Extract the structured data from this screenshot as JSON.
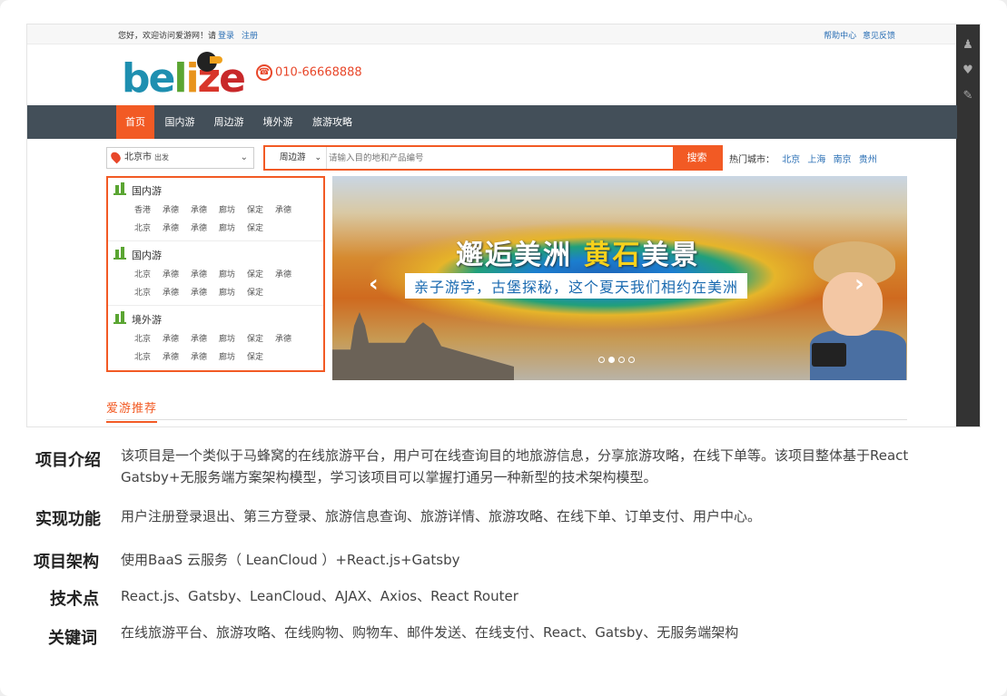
{
  "top": {
    "greeting": "您好，欢迎访问爱游网！请",
    "login": "登录",
    "register": "注册",
    "help": "帮助中心",
    "feedback": "意见反馈"
  },
  "logo": {
    "b": "b",
    "e": "e",
    "l": "l",
    "i": "i",
    "z": "z",
    "e2": "e"
  },
  "phone": "010-66668888",
  "nav": [
    "首页",
    "国内游",
    "周边游",
    "境外游",
    "旅游攻略"
  ],
  "city": {
    "name": "北京市",
    "suffix": "出发"
  },
  "search": {
    "category": "周边游",
    "placeholder": "请输入目的地和产品编号",
    "button": "搜索"
  },
  "hot": {
    "label": "热门城市：",
    "cities": [
      "北京",
      "上海",
      "南京",
      "贵州"
    ]
  },
  "menu": [
    {
      "title": "国内游",
      "row1": [
        "香港",
        "承德",
        "承德",
        "廊坊",
        "保定",
        "承德"
      ],
      "row2": [
        "北京",
        "承德",
        "承德",
        "廊坊",
        "保定"
      ]
    },
    {
      "title": "国内游",
      "row1": [
        "北京",
        "承德",
        "承德",
        "廊坊",
        "保定",
        "承德"
      ],
      "row2": [
        "北京",
        "承德",
        "承德",
        "廊坊",
        "保定"
      ]
    },
    {
      "title": "境外游",
      "row1": [
        "北京",
        "承德",
        "承德",
        "廊坊",
        "保定",
        "承德"
      ],
      "row2": [
        "北京",
        "承德",
        "承德",
        "廊坊",
        "保定"
      ]
    }
  ],
  "banner": {
    "h1a": "邂逅美洲",
    "h1b": "黄石",
    "h1c": "美景",
    "sub": "亲子游学，古堡探秘，这个夏天我们相约在美洲"
  },
  "recommend": "爱游推荐",
  "info": [
    {
      "label": "项目介绍",
      "lines": [
        "该项目是一个类似于马蜂窝的在线旅游平台，用户可在线查询目的地旅游信息，分享旅游攻略，在线下单等。该项目整体基于React",
        "Gatsby+无服务端方案架构模型，学习该项目可以掌握打通另一种新型的技术架构模型。"
      ]
    },
    {
      "label": "实现功能",
      "lines": [
        "用户注册登录退出、第三方登录、旅游信息查询、旅游详情、旅游攻略、在线下单、订单支付、用户中心。"
      ]
    },
    {
      "label": "项目架构",
      "lines": [
        "使用BaaS 云服务（ LeanCloud ）+React.js+Gatsby"
      ]
    },
    {
      "label": "技术点",
      "lines": [
        "React.js、Gatsby、LeanCloud、AJAX、Axios、React Router"
      ]
    },
    {
      "label": "关键词",
      "lines": [
        "在线旅游平台、旅游攻略、在线购物、购物车、邮件发送、在线支付、React、Gatsby、无服务端架构"
      ]
    }
  ]
}
